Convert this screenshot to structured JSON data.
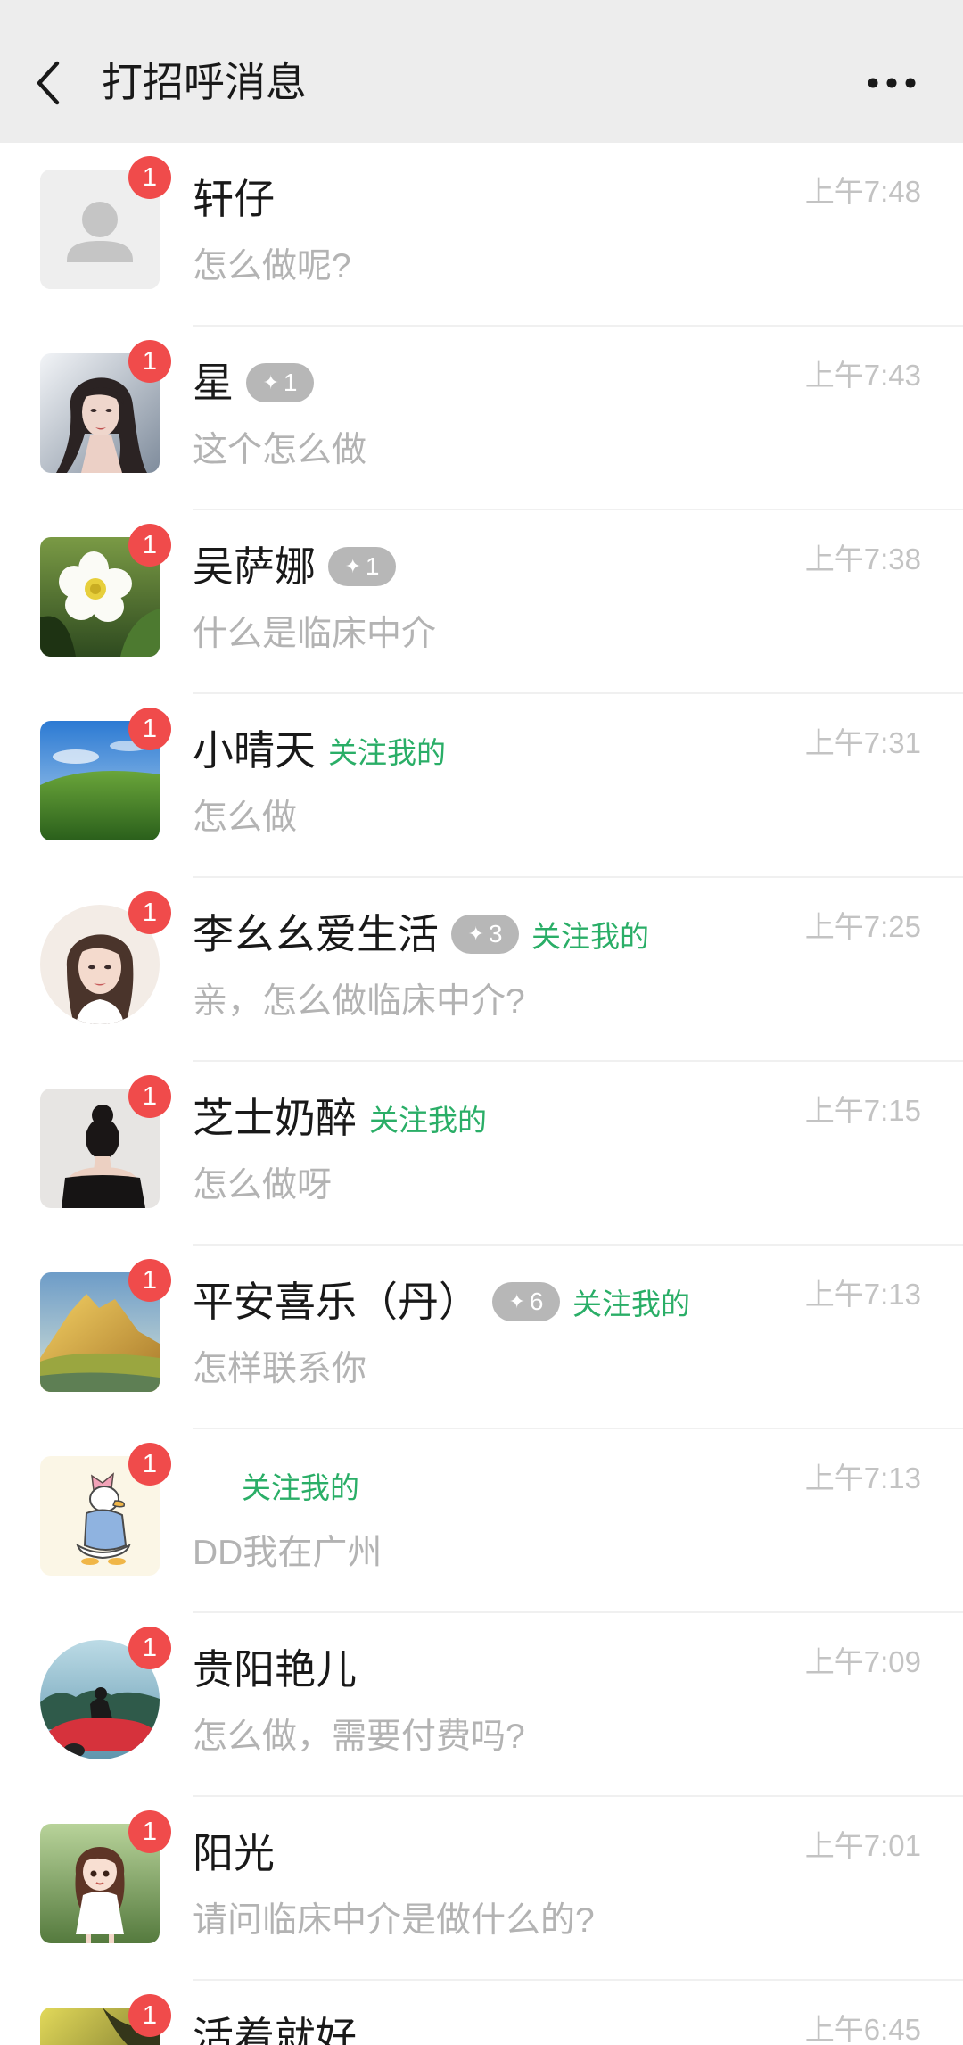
{
  "header": {
    "title": "打招呼消息",
    "back_icon": "chevron-left-icon",
    "more_icon": "more-dots-icon"
  },
  "boost_icon": "sparkle-icon",
  "colors": {
    "badge": "#f04b4b",
    "follow_tag": "#2aae67",
    "boost_tag": "#b7b7b7",
    "title_bar": "#ededed"
  },
  "rows": [
    {
      "name": "轩仔",
      "time": "上午7:48",
      "message": "怎么做呢?",
      "badge": "1"
    },
    {
      "name": "星",
      "boost": "1",
      "time": "上午7:43",
      "message": "这个怎么做",
      "badge": "1"
    },
    {
      "name": "吴萨娜",
      "boost": "1",
      "time": "上午7:38",
      "message": "什么是临床中介",
      "badge": "1"
    },
    {
      "name": "小晴天",
      "follow_tag": "关注我的",
      "time": "上午7:31",
      "message": "怎么做",
      "badge": "1"
    },
    {
      "name": "李幺幺爱生活",
      "boost": "3",
      "follow_tag": "关注我的",
      "time": "上午7:25",
      "message": "亲，怎么做临床中介?",
      "badge": "1"
    },
    {
      "name": "芝士奶醉",
      "follow_tag": "关注我的",
      "time": "上午7:15",
      "message": "怎么做呀",
      "badge": "1"
    },
    {
      "name": "平安喜乐（丹）",
      "boost": "6",
      "follow_tag": "关注我的",
      "time": "上午7:13",
      "message": "怎样联系你",
      "badge": "1"
    },
    {
      "follow_tag": "关注我的",
      "time": "上午7:13",
      "message": "DD我在广州",
      "badge": "1"
    },
    {
      "name": "贵阳艳儿",
      "time": "上午7:09",
      "message": "怎么做，需要付费吗?",
      "badge": "1"
    },
    {
      "name": "阳光",
      "time": "上午7:01",
      "message": "请问临床中介是做什么的?",
      "badge": "1"
    },
    {
      "name": "活着就好",
      "time": "上午6:45",
      "badge": "1"
    }
  ]
}
